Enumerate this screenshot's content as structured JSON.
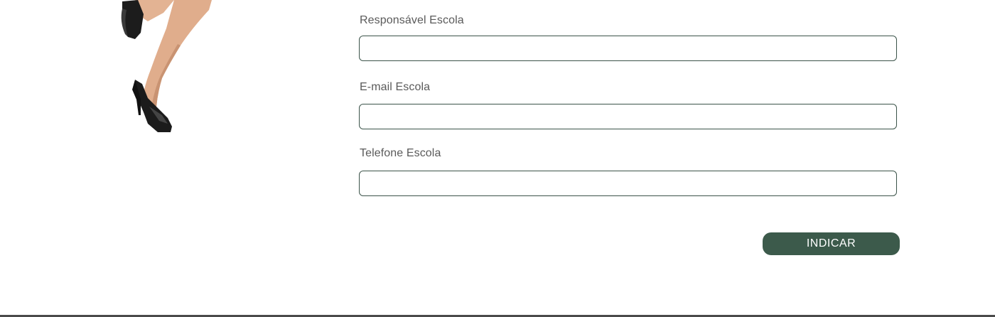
{
  "form": {
    "fields": [
      {
        "label": "Responsável Escola",
        "value": "",
        "placeholder": ""
      },
      {
        "label": "E-mail Escola",
        "value": "",
        "placeholder": ""
      },
      {
        "label": "Telefone Escola",
        "value": "",
        "placeholder": ""
      }
    ],
    "submit_label": "INDICAR"
  },
  "colors": {
    "accent": "#3c5a4b",
    "input_border": "#3b5349",
    "label_text": "#5a5a5a"
  },
  "illustration": {
    "icon": "woman-legs-high-heels-image"
  }
}
